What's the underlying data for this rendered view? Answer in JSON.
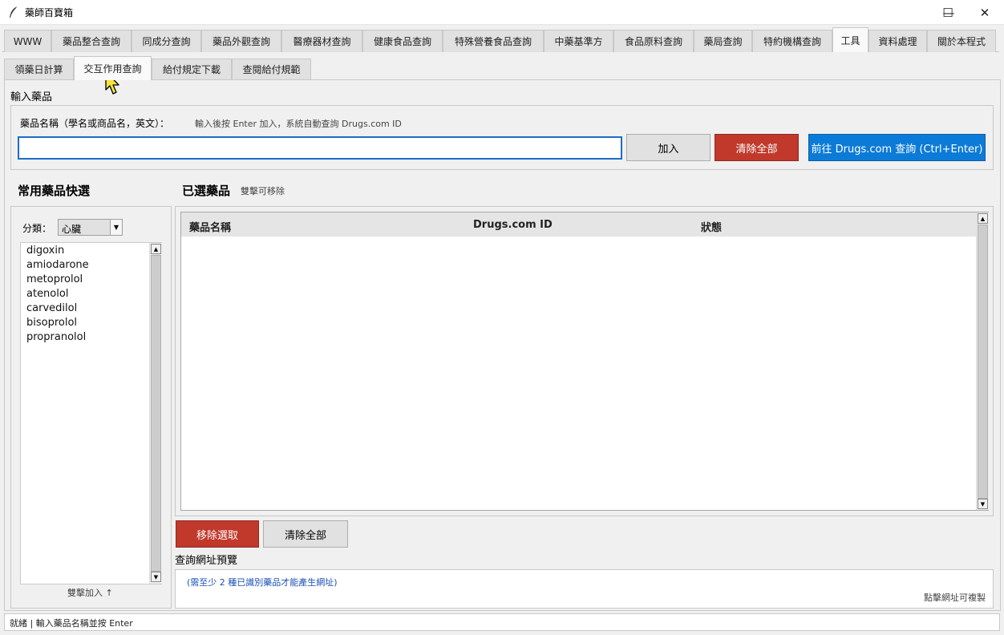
{
  "window": {
    "title": "藥師百寶箱",
    "minimize": "—",
    "maximize": "☐",
    "close": "✕"
  },
  "tabs": [
    {
      "label": "WWW"
    },
    {
      "label": "藥品整合查詢"
    },
    {
      "label": "同成分查詢"
    },
    {
      "label": "藥品外觀查詢"
    },
    {
      "label": "醫療器材查詢"
    },
    {
      "label": "健康食品查詢"
    },
    {
      "label": "特殊營養食品查詢"
    },
    {
      "label": "中藥基準方"
    },
    {
      "label": "食品原料查詢"
    },
    {
      "label": "藥局查詢"
    },
    {
      "label": "特約機構查詢"
    },
    {
      "label": "工具"
    },
    {
      "label": "資料處理"
    },
    {
      "label": "關於本程式"
    }
  ],
  "subtabs": [
    {
      "label": "領藥日計算"
    },
    {
      "label": "交互作用查詢"
    },
    {
      "label": "給付規定下載"
    },
    {
      "label": "查閱給付規範"
    }
  ],
  "input_section": {
    "title": "輸入藥品",
    "label": "藥品名稱（學名或商品名，英文）：",
    "hint": "輸入後按 Enter 加入，系統自動查詢 Drugs.com ID",
    "value": "",
    "add_button": "加入",
    "clear_all_button": "清除全部",
    "goto_button": "前往 Drugs.com 查詢 (Ctrl+Enter)"
  },
  "quick_select": {
    "title": "常用藥品快選",
    "category_label": "分類：",
    "category_value": "心臟",
    "items": [
      "digoxin",
      "amiodarone",
      "metoprolol",
      "atenolol",
      "carvedilol",
      "bisoprolol",
      "propranolol"
    ],
    "footer_hint": "雙擊加入 ↑"
  },
  "selected": {
    "title": "已選藥品",
    "hint": "雙擊可移除",
    "columns": [
      "藥品名稱",
      "Drugs.com ID",
      "狀態"
    ],
    "rows": [],
    "remove_button": "移除選取",
    "clear_all_button": "清除全部"
  },
  "url_preview": {
    "title": "查詢網址預覽",
    "message": "(需至少 2 種已識別藥品才能產生網址)",
    "hint": "點擊網址可複製"
  },
  "colors": {
    "accent_blue": "#0c7bd8",
    "danger_red": "#c0392b",
    "link_blue": "#1a4fb5"
  },
  "status_bar": "就緒 | 輸入藥品名稱並按 Enter"
}
